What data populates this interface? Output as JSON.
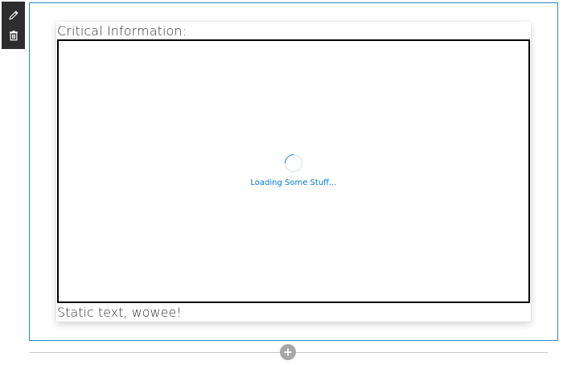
{
  "toolbar": {
    "edit_icon": "pencil-icon",
    "delete_icon": "trash-icon"
  },
  "webpart": {
    "critical_label": "Critical Information:",
    "loading_text": "Loading Some Stuff...",
    "static_text": "Static text, wowee!"
  },
  "canvas": {
    "add_section_icon": "plus-circle-icon"
  },
  "colors": {
    "accent": "#0078d4",
    "section_border": "#2d88c2",
    "toolbar_bg": "#2d2d2d"
  }
}
